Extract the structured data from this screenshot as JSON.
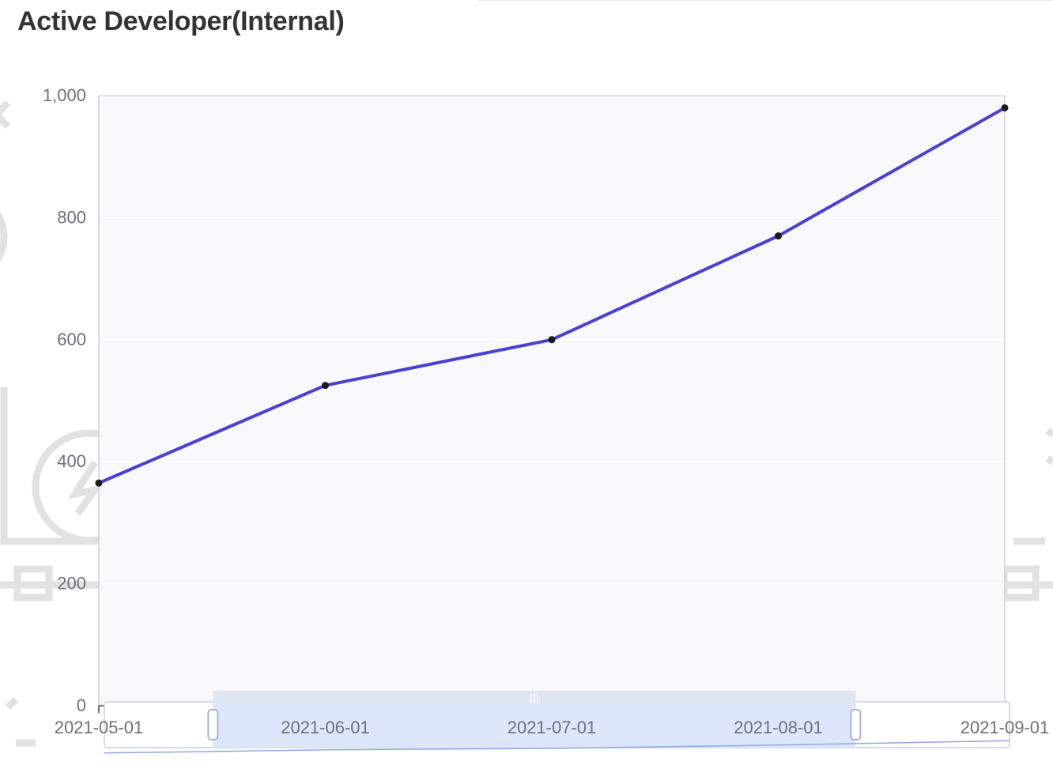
{
  "title": "Active Developer(Internal)",
  "colors": {
    "line": "#4b40d6",
    "point": "#1a1a1a",
    "plot_bg": "#f8f8fd",
    "grid": "#ffffff",
    "axis": "#6e7079",
    "zoom_fill": "#dbe5fb",
    "zoom_border": "#d2dbee"
  },
  "chart_data": {
    "type": "line",
    "title": "Active Developer(Internal)",
    "xlabel": "",
    "ylabel": "",
    "x": [
      "2021-05-01",
      "2021-06-01",
      "2021-07-01",
      "2021-08-01",
      "2021-09-01"
    ],
    "series": [
      {
        "values": [
          365,
          525,
          600,
          770,
          980
        ]
      }
    ],
    "ylim": [
      0,
      1000
    ],
    "yticks": [
      0,
      200,
      400,
      600,
      800,
      1000
    ],
    "ytick_labels": [
      "0",
      "200",
      "400",
      "600",
      "800",
      "1,000"
    ],
    "grid": true,
    "datazoom": {
      "start_fraction": 0.12,
      "end_fraction": 0.83
    }
  }
}
